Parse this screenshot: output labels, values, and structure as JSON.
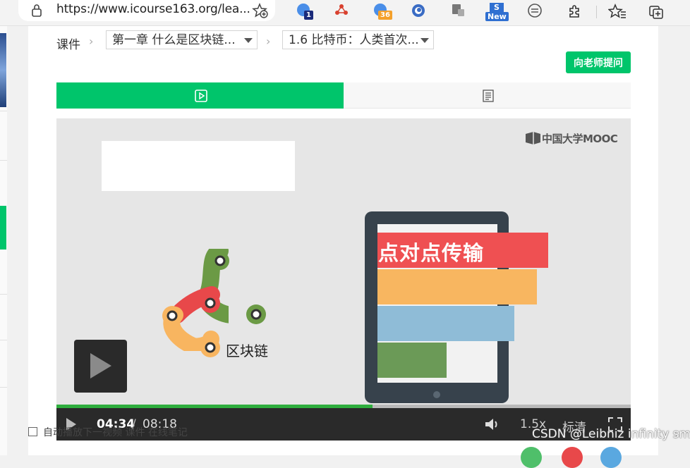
{
  "browser": {
    "url": "https://www.icourse163.org/lea...",
    "extensions": [
      {
        "name": "translate-extension-icon",
        "badge": "1"
      },
      {
        "name": "network-extension-icon",
        "badge": ""
      },
      {
        "name": "security-extension-icon",
        "badge": "36"
      },
      {
        "name": "circle-extension-icon",
        "badge": ""
      },
      {
        "name": "device-extension-icon",
        "badge": ""
      },
      {
        "name": "news-extension-icon",
        "badge": "New"
      },
      {
        "name": "browser-extension-icon",
        "badge": ""
      }
    ]
  },
  "breadcrumb": {
    "root": "课件",
    "chapter": "第一章 什么是区块链...",
    "lesson": "1.6 比特币：人类首次..."
  },
  "ask_button": "向老师提问",
  "video": {
    "watermark_logo": "中国大学MOOC",
    "chain_label": "区块链",
    "tablet_title": "点对点传输",
    "current_time": "04:34",
    "time_separator": "/",
    "total_time": "08:18",
    "progress": 0.55,
    "speed": "1.5x",
    "quality": "标清"
  },
  "bottom": {
    "text": "自动播放下一视频   课件 在线笔记",
    "watermark": "CSDN @Leibniz infinity sml"
  },
  "colors": {
    "accent": "#00c56b",
    "player_bg": "#e6e6e6",
    "controls_bg": "#2a2a2a",
    "progress": "#2fae3e"
  }
}
